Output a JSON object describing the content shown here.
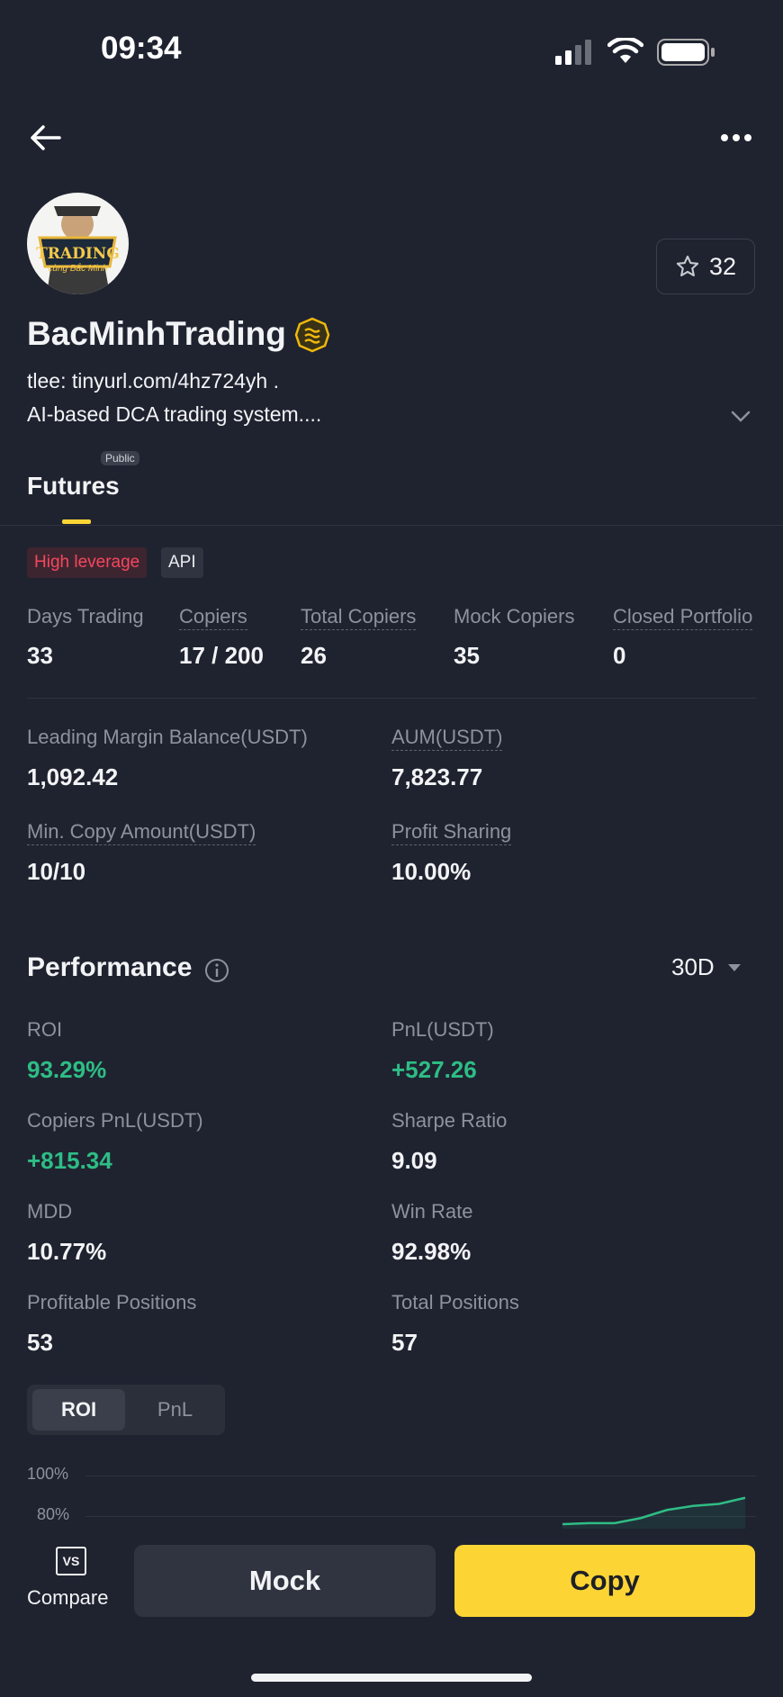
{
  "status": {
    "time": "09:34"
  },
  "profile": {
    "name": "BacMinhTrading",
    "bio_line1": "tlee: tinyurl.com/4hz724yh .",
    "bio_line2": "AI-based DCA trading system....",
    "favorites": "32",
    "avatar_text1": "TRADING",
    "avatar_text2": "cùng Bắc Minh"
  },
  "tabs": {
    "futures": "Futures",
    "public_badge": "Public"
  },
  "tags": {
    "high_leverage": "High leverage",
    "api": "API"
  },
  "stats": [
    {
      "label": "Days Trading",
      "value": "33"
    },
    {
      "label": "Copiers",
      "value": "17 / 200"
    },
    {
      "label": "Total Copiers",
      "value": "26"
    },
    {
      "label": "Mock Copiers",
      "value": "35"
    },
    {
      "label": "Closed Portfolio",
      "value": "0"
    }
  ],
  "balance": {
    "leading_margin_label": "Leading Margin Balance(USDT)",
    "leading_margin_value": "1,092.42",
    "aum_label": "AUM(USDT)",
    "aum_value": "7,823.77",
    "min_copy_label": "Min. Copy Amount(USDT)",
    "min_copy_value": "10/10",
    "profit_sharing_label": "Profit Sharing",
    "profit_sharing_value": "10.00%"
  },
  "performance": {
    "title": "Performance",
    "period": "30D",
    "roi_label": "ROI",
    "roi_value": "93.29%",
    "pnl_label": "PnL(USDT)",
    "pnl_value": "+527.26",
    "copiers_pnl_label": "Copiers PnL(USDT)",
    "copiers_pnl_value": "+815.34",
    "sharpe_label": "Sharpe Ratio",
    "sharpe_value": "9.09",
    "mdd_label": "MDD",
    "mdd_value": "10.77%",
    "winrate_label": "Win Rate",
    "winrate_value": "92.98%",
    "profitable_label": "Profitable Positions",
    "profitable_value": "53",
    "total_label": "Total Positions",
    "total_value": "57",
    "toggle_roi": "ROI",
    "toggle_pnl": "PnL"
  },
  "chart_data": {
    "type": "line",
    "y_ticks": [
      "100%",
      "80%"
    ],
    "series": [
      {
        "values": [
          76,
          76.5,
          76.5,
          79,
          83,
          85,
          86,
          89
        ]
      }
    ]
  },
  "bottom_bar": {
    "compare": "Compare",
    "compare_icon": "VS",
    "mock": "Mock",
    "copy": "Copy"
  },
  "colors": {
    "background": "#1f2330",
    "accent": "#fcd535",
    "positive": "#2ebd85",
    "negative": "#f6465d"
  }
}
